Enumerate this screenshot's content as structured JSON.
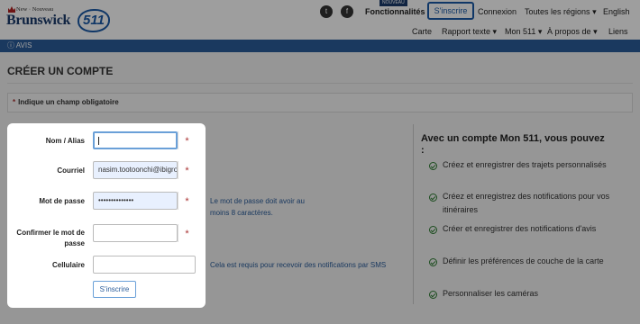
{
  "header": {
    "logo_small": "New · Nouveau",
    "logo_big": "Brunswick",
    "logo_badge": "511",
    "social": [
      "twitter-icon",
      "facebook-icon"
    ],
    "features_label": "Fonctionnalités",
    "new_badge": "NOUVEAU",
    "signup_label": "S'inscrire",
    "login_label": "Connexion",
    "regions_label": "Toutes les régions",
    "language_label": "English",
    "subnav": [
      "Carte",
      "Rapport texte",
      "Mon 511",
      "À propos de",
      "Liens"
    ]
  },
  "alert_bar": {
    "label": "AVIS"
  },
  "page": {
    "title": "CRÉER UN COMPTE",
    "required_note": "Indique un champ obligatoire",
    "required_symbol": "*"
  },
  "form": {
    "fields": [
      {
        "label": "Nom / Alias",
        "value": "",
        "required": true
      },
      {
        "label": "Courriel",
        "value": "nasim.tootoonchi@ibigroup",
        "required": true
      },
      {
        "label": "Mot de passe",
        "value": "••••••••••••••",
        "required": true
      },
      {
        "label": "Confirmer le mot de passe",
        "value": "",
        "required": true
      },
      {
        "label": "Cellulaire",
        "value": "",
        "required": false
      }
    ],
    "submit_label": "S'inscrire"
  },
  "hints": {
    "password": "Le mot de passe doit avoir au moins 8 caractères.",
    "cell": "Cela est requis pour recevoir des notifications par SMS"
  },
  "benefits": {
    "title": "Avec un compte Mon 511, vous pouvez :",
    "items": [
      "Créez et enregistrer des trajets personnalisés",
      "Créez et enregistrez des notifications pour vos itinéraires",
      "Créer et enregistrer des notifications d'avis",
      "Définir les préférences de couche de la carte",
      "Personnaliser les caméras"
    ]
  },
  "colors": {
    "brand_blue": "#2a5c9a",
    "required_red": "#a33333",
    "check_green": "#2e7d32"
  }
}
